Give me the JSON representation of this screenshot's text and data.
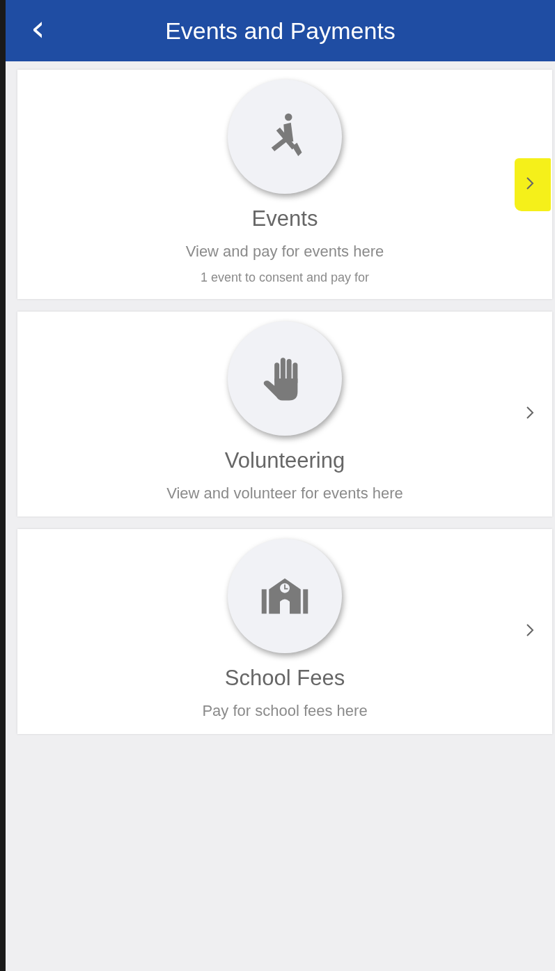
{
  "header": {
    "back_icon": "‹",
    "title": "Events and Payments"
  },
  "cards": [
    {
      "kind": "rowing",
      "title": "Events",
      "subtitle": "View and pay for events here",
      "detail": "1 event to consent and pay for",
      "highlighted": true
    },
    {
      "kind": "hand",
      "title": "Volunteering",
      "subtitle": "View and volunteer for events here",
      "highlighted": false
    },
    {
      "kind": "school",
      "title": "School Fees",
      "subtitle": "Pay for school fees here",
      "highlighted": false
    }
  ]
}
